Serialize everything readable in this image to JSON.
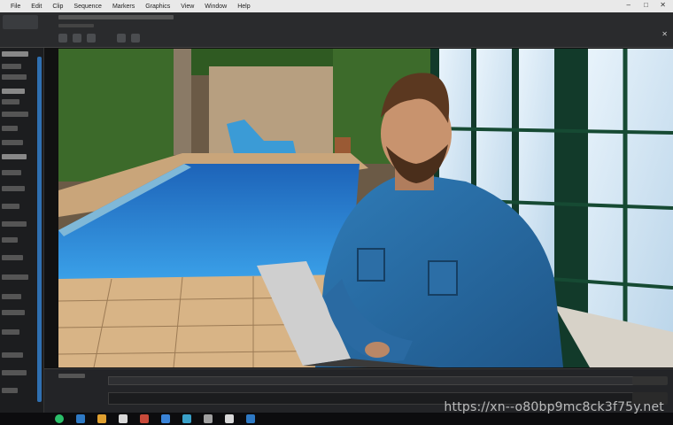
{
  "menu": {
    "items": [
      "File",
      "Edit",
      "Clip",
      "Sequence",
      "Markers",
      "Graphics",
      "View",
      "Window",
      "Help"
    ],
    "window_controls": [
      "–",
      "□",
      "✕"
    ]
  },
  "header": {
    "close_glyph": "✕"
  },
  "viewport": {
    "scene": "pool-man-laptop"
  },
  "watermark": {
    "text": "https://xn--o80bp9mc8ck3f75y.net"
  },
  "colors": {
    "accent": "#2f6fb0",
    "pool": "#2e86d6",
    "shirt": "#2a6ea8"
  },
  "icons": {
    "taskbar": [
      "start-icon",
      "search-icon",
      "folder-icon",
      "browser-icon",
      "mail-icon",
      "store-icon",
      "app-icon",
      "photos-icon",
      "settings-icon",
      "media-icon"
    ]
  }
}
